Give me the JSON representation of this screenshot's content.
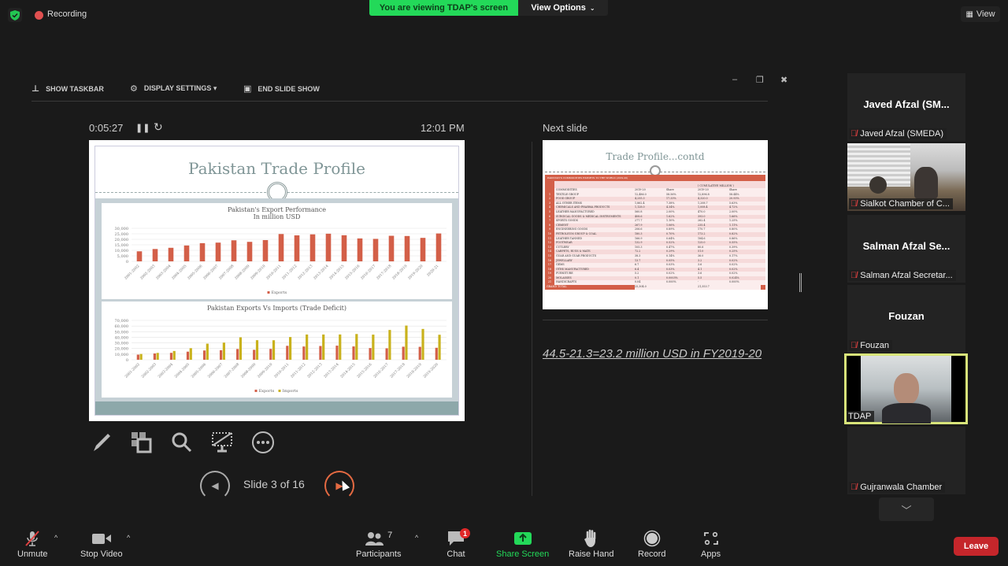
{
  "top_bar": {
    "recording_label": "Recording",
    "viewing_banner": "You are viewing TDAP's screen",
    "view_options_label": "View Options",
    "view_label": "View"
  },
  "presenter_view": {
    "toolbar": {
      "show_taskbar": "SHOW TASKBAR",
      "display_settings": "DISPLAY SETTINGS ▾",
      "end_slide_show": "END SLIDE SHOW"
    },
    "window_controls": {
      "minimize": "–",
      "restore": "❐",
      "close": "✖"
    },
    "timer": "0:05:27",
    "clock": "12:01 PM",
    "slide_counter": "Slide 3 of 16",
    "next_slide_label": "Next slide",
    "notes": "44.5-21.3=23.2 million USD in FY2019-20",
    "current_slide": {
      "title": "Pakistan Trade Profile"
    },
    "next_slide": {
      "title": "Trade Profile...contd",
      "banner": "PAKISTAN'S COMMODITIES EXPORTS TO THE WORLD (2019-20)",
      "subheader": "( CUMULATIVE MILLION )",
      "columns": [
        "COMMODITIES",
        "2019-20",
        "Share",
        "2019-20",
        "Share"
      ],
      "rows": [
        [
          "TEXTILE GROUP",
          "12,486.0",
          "58.56%",
          "12,896.8",
          "58.44%"
        ],
        [
          "FOOD GROUP",
          "4,255.3",
          "17.33%",
          "4,320.0",
          "20.93%"
        ],
        [
          "ALL OTHER ITEMS",
          "1,862.4",
          "7.38%",
          "1,208.7",
          "5.63%"
        ],
        [
          "CHEMICALS AND PHARMA PRODUCTS",
          "1,128.0",
          "4.34%",
          "1,008.4",
          "4.72%"
        ],
        [
          "LEATHER MANUFACTURED",
          "560.8",
          "2.00%",
          "470.0",
          "2.00%"
        ],
        [
          "SURGICAL GOODS & MEDICAL INSTRUMENTS",
          "408.6",
          "1.62%",
          "393.0",
          "1.66%"
        ],
        [
          "SPORTS GOODS",
          "277.7",
          "1.10%",
          "262.4",
          "1.25%"
        ],
        [
          "CEMENT",
          "267.9",
          "1.06%",
          "235.4",
          "1.11%"
        ],
        [
          "ENGINEERING GOODS",
          "206.6",
          "0.89%",
          "170.7",
          "0.80%"
        ],
        [
          "PETROLEUM GROUP & COAL",
          "180.3",
          "0.70%",
          "173.2",
          "0.82%"
        ],
        [
          "LEATHER TANNED",
          "166.9",
          "0.64%",
          "184.6",
          "0.86%"
        ],
        [
          "FOOTWEAR",
          "132.9",
          "0.52%",
          "125.0",
          "0.55%"
        ],
        [
          "CUTLERY",
          "105.3",
          "0.47%",
          "80.6",
          "0.39%"
        ],
        [
          "CARPETS, RUGS & MATS",
          "72.2",
          "0.29%",
          "51.0",
          "0.25%"
        ],
        [
          "GUAR AND GUAR PRODUCTS",
          "38.3",
          "0.14%",
          "36.0",
          "0.17%"
        ],
        [
          "JEWELLARY",
          "13.7",
          "0.05%",
          "3.2",
          "0.02%"
        ],
        [
          "GEMS",
          "6.7",
          "0.03%",
          "3.6",
          "0.02%"
        ],
        [
          "OTHS MANUFACTURED",
          "6.4",
          "0.03%",
          "4.1",
          "0.02%"
        ],
        [
          "FURNITURE",
          "5.2",
          "0.02%",
          "3.6",
          "0.02%"
        ],
        [
          "MOLASSES",
          "0.1",
          "0.0003%",
          "5.5",
          "0.024%"
        ],
        [
          "HANDICRAFTS",
          "0.04",
          "0.000%",
          "-",
          "0.000%"
        ]
      ],
      "total_label": "GRAND TOTAL",
      "total_values": [
        "25,304.0",
        "",
        "21,353.7",
        ""
      ]
    }
  },
  "chart_data": [
    {
      "type": "bar",
      "title": "Pakistan's Export Performance In million USD",
      "categories": [
        "2001-2002",
        "2002-2003",
        "2003-2004",
        "2004-2005",
        "2005-2006",
        "2006-2007",
        "2007-2008",
        "2008-2009",
        "2009-2010",
        "2010-2011",
        "2011-2012",
        "2012-2013",
        "2013-2014",
        "2014-2015",
        "2015-2016",
        "2016-2017",
        "2017-2018",
        "2018-2019",
        "2019-2020",
        "2020-21"
      ],
      "series": [
        {
          "name": "Exports",
          "color": "#d35f48",
          "values": [
            9100,
            11200,
            12300,
            14400,
            16500,
            17000,
            19100,
            17700,
            19300,
            24800,
            23600,
            24500,
            25100,
            23700,
            20800,
            20400,
            23200,
            23000,
            21300,
            25300
          ]
        }
      ],
      "yticks": [
        "0",
        "5,000",
        "10,000",
        "15,000",
        "20,000",
        "25,000",
        "30,000"
      ],
      "ylim": [
        0,
        30000
      ],
      "legend": "bottom",
      "grid": true
    },
    {
      "type": "bar",
      "title": "Pakistan Exports Vs Imports (Trade Deficit)",
      "categories": [
        "2001-2002",
        "2002-2003",
        "2003-2004",
        "2004-2005",
        "2005-2006",
        "2006-2007",
        "2007-2008",
        "2008-2009",
        "2009-2010",
        "2010-2011",
        "2011-2012",
        "2012-2013",
        "2013-2014",
        "2014-2015",
        "2015-2016",
        "2016-2017",
        "2017-2018",
        "2018-2019",
        "2019-2020"
      ],
      "series": [
        {
          "name": "Exports",
          "color": "#d35f48",
          "values": [
            9100,
            11200,
            12300,
            14400,
            16500,
            17000,
            19100,
            17700,
            19300,
            24800,
            23600,
            24500,
            25100,
            23700,
            20800,
            20400,
            23200,
            23000,
            21300
          ]
        },
        {
          "name": "Imports",
          "color": "#c9b21c",
          "values": [
            10300,
            12200,
            15600,
            20600,
            28600,
            30500,
            39900,
            34800,
            34700,
            40400,
            44900,
            44900,
            45000,
            45800,
            44700,
            53000,
            60800,
            54800,
            44500
          ]
        }
      ],
      "yticks": [
        "0",
        "10,000",
        "20,000",
        "30,000",
        "40,000",
        "50,000",
        "60,000",
        "70,000"
      ],
      "ylim": [
        0,
        70000
      ],
      "legend": "bottom",
      "grid": true
    }
  ],
  "gallery": {
    "tiles": [
      {
        "display_name": "Javed Afzal (SM...",
        "label": "Javed Afzal (SMEDA)",
        "video": false,
        "muted": true
      },
      {
        "display_name": "",
        "label": "Sialkot Chamber of C...",
        "video": true,
        "muted": true
      },
      {
        "display_name": "Salman Afzal Se...",
        "label": "Salman Afzal Secretar...",
        "video": false,
        "muted": true
      },
      {
        "display_name": "Fouzan",
        "label": "Fouzan",
        "video": false,
        "muted": true
      },
      {
        "display_name": "",
        "label": "TDAP",
        "video": true,
        "muted": false,
        "active_speaker": true
      },
      {
        "display_name": "",
        "label": "Gujranwala Chamber",
        "video": false,
        "muted": true
      }
    ]
  },
  "toolbar": {
    "unmute": "Unmute",
    "stop_video": "Stop Video",
    "participants": "Participants",
    "participants_count": "7",
    "chat": "Chat",
    "chat_badge": "1",
    "share_screen": "Share Screen",
    "raise_hand": "Raise Hand",
    "record": "Record",
    "apps": "Apps",
    "leave": "Leave"
  },
  "colors": {
    "zoom_green": "#23d959",
    "leave_red": "#c5262b",
    "active_speaker": "#d8e47a",
    "next_accent": "#e56a42"
  }
}
